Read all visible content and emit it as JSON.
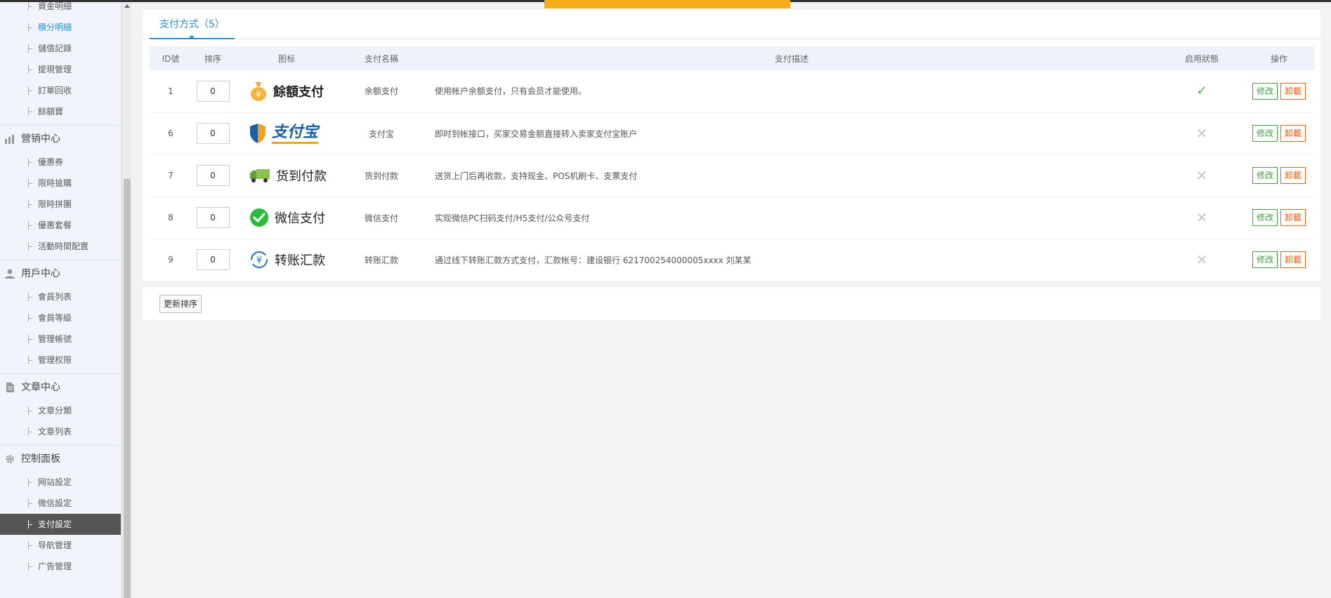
{
  "sidebar": {
    "top_items": [
      {
        "label": "資金明細"
      },
      {
        "label": "積分明細",
        "highlight": true
      },
      {
        "label": "儲值記錄"
      },
      {
        "label": "提現管理"
      },
      {
        "label": "訂單回收"
      },
      {
        "label": "餘額寶"
      }
    ],
    "groups": [
      {
        "title": "營销中心",
        "icon": "chart-icon",
        "items": [
          {
            "label": "優惠券"
          },
          {
            "label": "限時搶購"
          },
          {
            "label": "限時拼團"
          },
          {
            "label": "優惠套餐"
          },
          {
            "label": "活動時間配置"
          }
        ]
      },
      {
        "title": "用戶中心",
        "icon": "user-icon",
        "items": [
          {
            "label": "會員列表"
          },
          {
            "label": "會員等級"
          },
          {
            "label": "管理帳號"
          },
          {
            "label": "管理权限"
          }
        ]
      },
      {
        "title": "文章中心",
        "icon": "document-icon",
        "items": [
          {
            "label": "文章分類"
          },
          {
            "label": "文章列表"
          }
        ]
      },
      {
        "title": "控制面板",
        "icon": "gear-icon",
        "items": [
          {
            "label": "网站設定"
          },
          {
            "label": "微信設定"
          },
          {
            "label": "支付設定",
            "active": true
          },
          {
            "label": "导航管理"
          },
          {
            "label": "广告管理"
          }
        ]
      }
    ]
  },
  "tab": {
    "label": "支付方式（5）"
  },
  "table": {
    "headers": {
      "id": "ID號",
      "sort": "排序",
      "icon": "图标",
      "name": "支付名稱",
      "desc": "支付描述",
      "status": "启用狀態",
      "ops": "操作"
    },
    "rows": [
      {
        "id": "1",
        "sort": "0",
        "logo_text": "餘額支付",
        "logo_icon": "money-bag-icon",
        "name": "余额支付",
        "desc": "使用帐户余额支付，只有会员才能使用。",
        "enabled": true,
        "status_glyph": "✓"
      },
      {
        "id": "6",
        "sort": "0",
        "logo_text": "支付宝",
        "logo_icon": "alipay-shield-icon",
        "name": "支付宝",
        "desc": "即时到帐接口，买家交易金额直接转入卖家支付宝账户",
        "enabled": false,
        "status_glyph": "✕"
      },
      {
        "id": "7",
        "sort": "0",
        "logo_text": "货到付款",
        "logo_icon": "truck-icon",
        "name": "货到付款",
        "desc": "送货上门后再收款，支持现金、POS机刷卡、支票支付",
        "enabled": false,
        "status_glyph": "✕"
      },
      {
        "id": "8",
        "sort": "0",
        "logo_text": "微信支付",
        "logo_icon": "wechat-icon",
        "name": "微信支付",
        "desc": "实现微信PC扫码支付/H5支付/公众号支付",
        "enabled": false,
        "status_glyph": "✕"
      },
      {
        "id": "9",
        "sort": "0",
        "logo_text": "转账汇款",
        "logo_icon": "transfer-yuan-icon",
        "name": "转账汇款",
        "desc": "通过线下转账汇款方式支付，汇款帐号：建设银行 621700254000005xxxx 刘某某",
        "enabled": false,
        "status_glyph": "✕"
      }
    ],
    "edit_label": "修改",
    "delete_label": "卸載"
  },
  "footer": {
    "update_sort_label": "更新排序"
  },
  "colors": {
    "accent": "#2a8fd6",
    "enabled": "#4caf50",
    "edit": "#44a244",
    "delete": "#e8621b",
    "top_bar": "#f6ad1c"
  }
}
